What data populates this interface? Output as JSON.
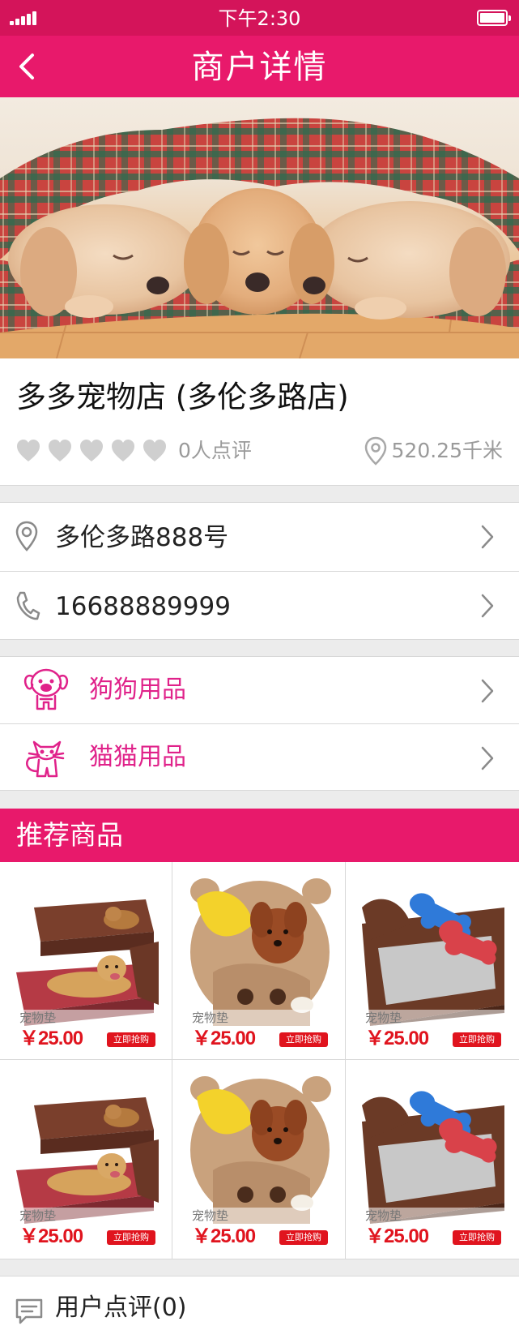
{
  "status_bar": {
    "time": "下午2:30",
    "signal_icon": "signal-icon",
    "battery_icon": "battery-icon"
  },
  "nav": {
    "title": "商户详情",
    "back_icon": "chevron-left-icon"
  },
  "hero": {
    "icon": "puppies-photo"
  },
  "shop": {
    "name": "多多宠物店 (多伦多路店)",
    "rating_icons": [
      "heart-icon",
      "heart-icon",
      "heart-icon",
      "heart-icon",
      "heart-icon"
    ],
    "review_count": "0人点评",
    "distance": "520.25千米"
  },
  "contact": {
    "address": "多伦多路888号",
    "phone": "16688889999"
  },
  "categories": [
    {
      "label": "狗狗用品",
      "icon": "dog-icon"
    },
    {
      "label": "猫猫用品",
      "icon": "cat-icon"
    }
  ],
  "recommended": {
    "title": "推荐商品",
    "products": [
      {
        "name": "宠物垫",
        "price": "￥25.00",
        "buy": "立即抢购",
        "image": "dog-bed-golden-retriever"
      },
      {
        "name": "宠物垫",
        "price": "￥25.00",
        "buy": "立即抢购",
        "image": "bear-bed-poodle"
      },
      {
        "name": "宠物垫",
        "price": "￥25.00",
        "buy": "立即抢购",
        "image": "bed-with-bone-toys"
      },
      {
        "name": "宠物垫",
        "price": "￥25.00",
        "buy": "立即抢购",
        "image": "dog-bed-golden-retriever"
      },
      {
        "name": "宠物垫",
        "price": "￥25.00",
        "buy": "立即抢购",
        "image": "bear-bed-poodle"
      },
      {
        "name": "宠物垫",
        "price": "￥25.00",
        "buy": "立即抢购",
        "image": "bed-with-bone-toys"
      }
    ]
  },
  "reviews": {
    "label": "用户点评(0)",
    "icon": "comment-icon"
  },
  "colors": {
    "accent": "#e8196b",
    "status_bar": "#d4145a",
    "category_text": "#e0228a",
    "price": "#e0141e"
  }
}
